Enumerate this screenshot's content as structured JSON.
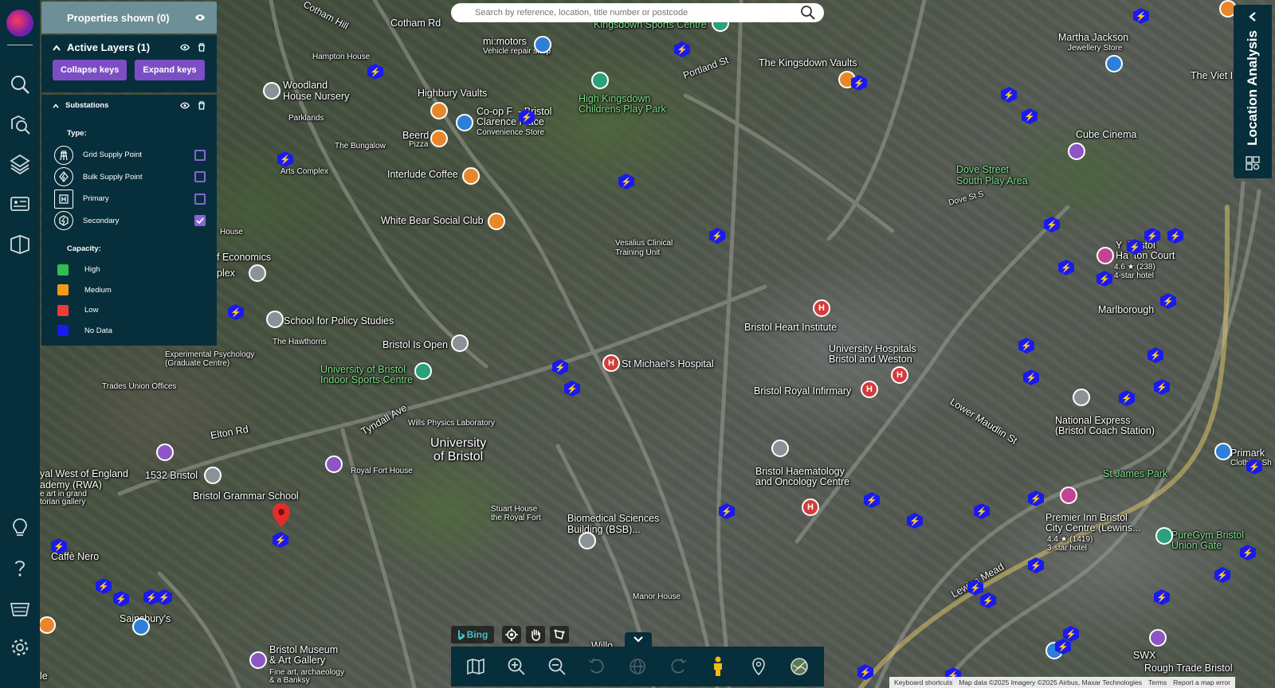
{
  "header": {
    "properties_label": "Properties shown (0)",
    "active_layers_label": "Active Layers (1)",
    "collapse_keys": "Collapse keys",
    "expand_keys": "Expand keys"
  },
  "substations": {
    "title": "Substations",
    "type_heading": "Type:",
    "types": [
      {
        "label": "Grid Supply Point",
        "checked": false,
        "icon": "grid-supply-icon"
      },
      {
        "label": "Bulk Supply Point",
        "checked": false,
        "icon": "bulk-supply-icon"
      },
      {
        "label": "Primary",
        "checked": false,
        "icon": "primary-icon"
      },
      {
        "label": "Secondary",
        "checked": true,
        "icon": "secondary-icon"
      }
    ],
    "capacity_heading": "Capacity:",
    "capacity": [
      {
        "label": "High",
        "color": "#2fbf4e"
      },
      {
        "label": "Medium",
        "color": "#f59a14"
      },
      {
        "label": "Low",
        "color": "#ee3b33"
      },
      {
        "label": "No Data",
        "color": "#1a1aee"
      }
    ]
  },
  "search": {
    "placeholder": "Search by reference, location, title number or postcode"
  },
  "location_analysis": {
    "label": "Location Analysis"
  },
  "map": {
    "provider": "Bing",
    "labels": {
      "cotham_hill": "Cotham Hill",
      "cotham_rd": "Cotham Rd",
      "kingsdown_sports": "Kingsdown Sports Centre",
      "mi_motors": "mi:motors",
      "mi_motors_sub": "Vehicle repair shop",
      "portland_st": "Portland St",
      "kingsdown_vaults": "The Kingsdown Vaults",
      "martha_jackson": "Martha Jackson",
      "martha_jackson_sub": "Jewellery Store",
      "viet": "The Viet I",
      "hampton_house": "Hampton House",
      "woodland_nursery": "Woodland\nHouse Nursery",
      "parklands": "Parklands",
      "highbury_vaults": "Highbury Vaults",
      "high_kingsdown": "High Kingsdown\nChildrens Play Park",
      "coop": "Co-op F  - Bristol\nClarence Place",
      "coop_sub": "Convenience Store",
      "beerd": "Beerd",
      "beerd_sub": "Pizza",
      "bungalow": "The Bungalow",
      "arts_complex": "Arts Complex",
      "interlude": "Interlude Coffee",
      "white_bear": "White Bear Social Club",
      "cube_cinema": "Cube Cinema",
      "dove_street": "Dove Street\nSouth Play Area",
      "dove_st_s": "Dove St S",
      "vesalius": "Vesalius Clinical\nTraining Unit",
      "economics": "f Economics",
      "plex": "plex",
      "house": "House",
      "policy_studies": "School for Policy Studies",
      "hawthorns": "The Hawthorns",
      "exp_psych": "Experimental Psychology\n(Graduate Centre)",
      "bristol_is_open": "Bristol Is Open",
      "uob_indoor": "University of Bristol\nIndoor Sports Centre",
      "st_michaels": "St Michael's Hospital",
      "heart_institute": "Bristol Heart Institute",
      "uni_hospitals": "University Hospitals\nBristol and Weston",
      "royal_infirmary": "Bristol Royal Infirmary",
      "trades_union": "Trades Union Offices",
      "elton_rd": "Elton Rd",
      "tyndall_ave": "Tyndall Ave",
      "wills_physics": "Wills Physics Laboratory",
      "uob": "University\nof Bristol",
      "royal_fort_house": "Royal Fort House",
      "west_england": "yal West of England\nademy (RWA)",
      "west_england_sub": "e art in grand\ntorian gallery",
      "1532": "1532 Bristol",
      "grammar": "Bristol Grammar School",
      "cafe_nero": "Caffè Nero",
      "sainsburys": "Sainsbury's",
      "bristol_museum": "Bristol Museum\n& Art Gallery",
      "bristol_museum_sub": "Fine art, archaeology\n& a Banksy",
      "stuart_house": "Stuart House\nthe Royal Fort",
      "biomedical": "Biomedical Sciences\nBuilding (BSB)...",
      "manor_house": "Manor House",
      "haematology": "Bristol Haematology\nand Oncology Centre",
      "national_express": "National Express\n(Bristol Coach Station)",
      "st_james_park": "St James Park",
      "premier_inn": "Premier Inn Bristol\nCity Centre (Lewins...",
      "premier_inn_sub": "4.4 ★ (1419)\n3-star hotel",
      "puregym": "PureGym Bristol\nUnion Gate",
      "primark": "Primark",
      "primark_sub": "Clothing Sh",
      "hampton_court": "Y  Bristol\nHa  ton Court",
      "hampton_court_sub": "4.6 ★ (238)\n4-star hotel",
      "rough_trade": "Rough Trade Bristol",
      "swx": "SWX",
      "marlborough": "Marlborough",
      "lewins_mead": "Lewins Mead",
      "lower_maudlin": "Lower Maudlin St",
      "willow": "Willo",
      "left_edge": "le"
    }
  },
  "attribution": {
    "shortcuts": "Keyboard shortcuts",
    "data": "Map data ©2025 Imagery ©2025 Airbus, Maxar Technologies",
    "terms": "Terms",
    "report": "Report a map error"
  },
  "colors": {
    "panel": "#072f3b",
    "accent": "#7c4ec4",
    "substation": "#1a1aee"
  }
}
